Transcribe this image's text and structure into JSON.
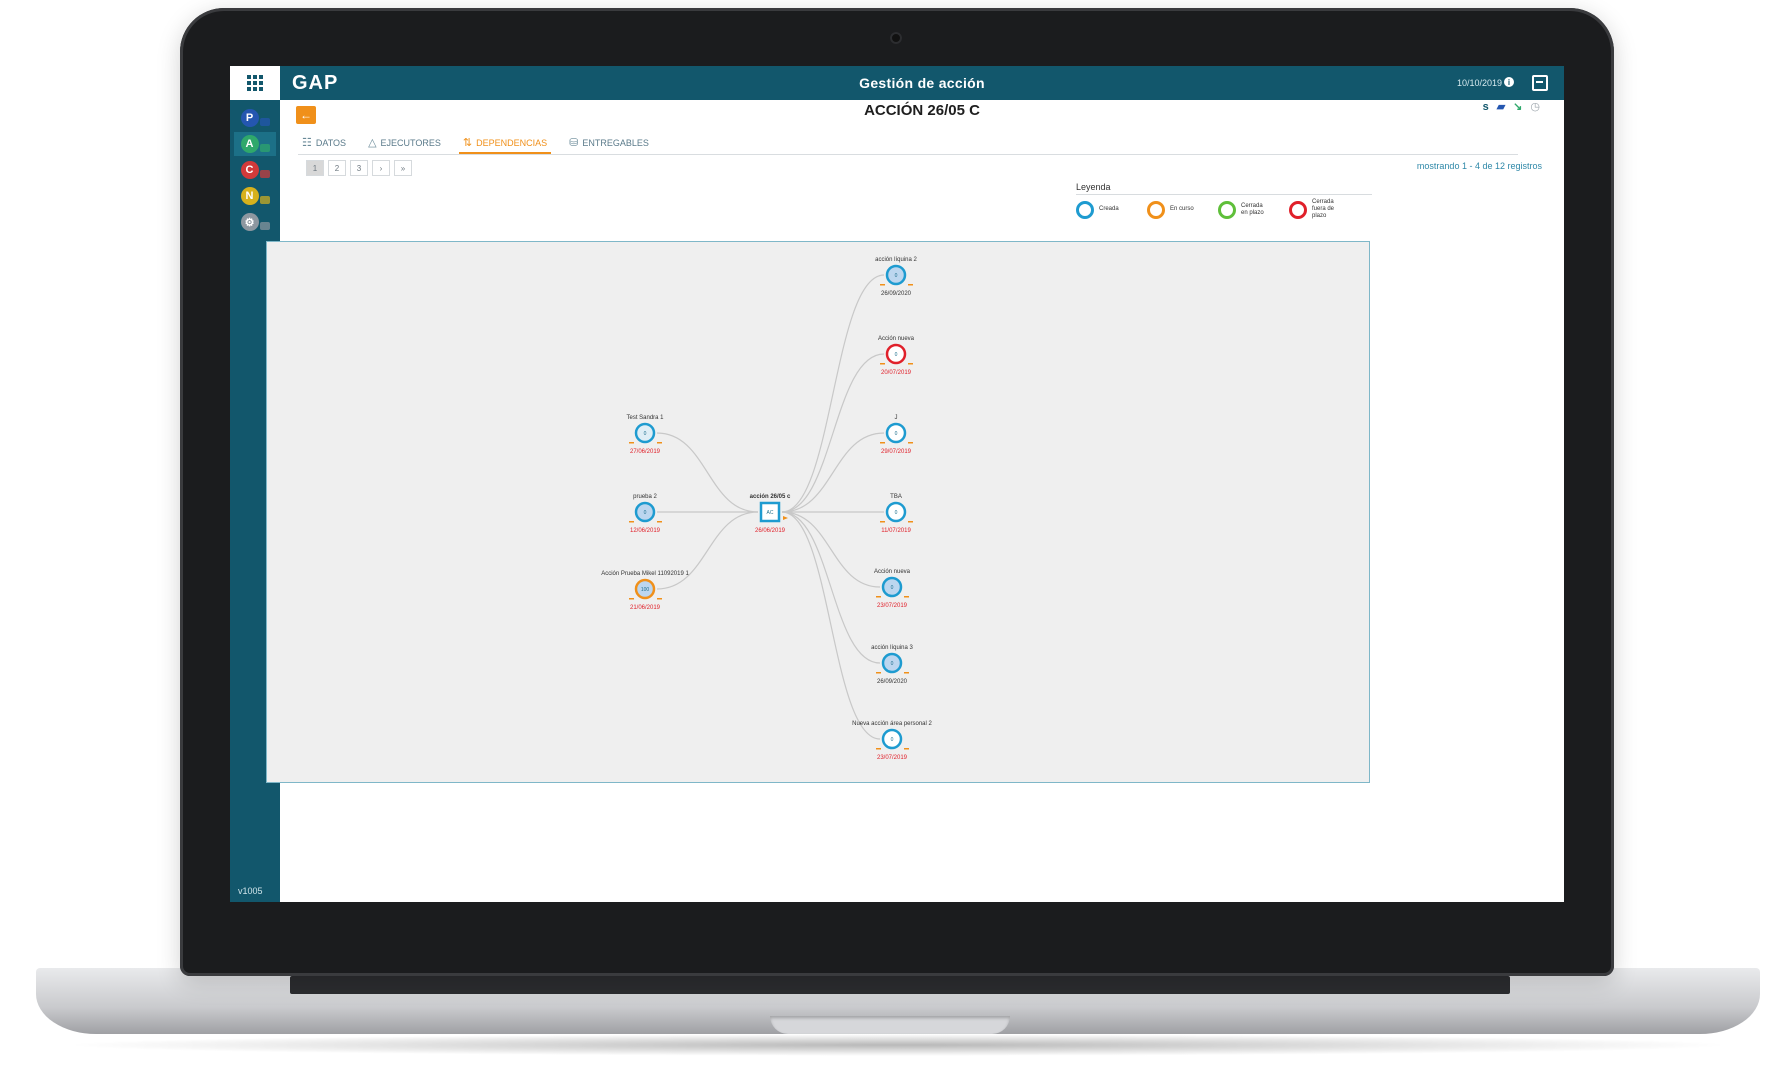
{
  "app": {
    "logo": "GAP",
    "title": "Gestión de acción",
    "date": "10/10/2019",
    "version": "v1005"
  },
  "page": {
    "title": "ACCIÓN 26/05 C",
    "back_icon": "arrow-left-icon",
    "toolbar_icons": [
      "s",
      "folder-icon",
      "tree-icon",
      "clock-icon"
    ]
  },
  "sidebar": {
    "modules": [
      {
        "letter": "P",
        "color": "#2456b0",
        "active": false
      },
      {
        "letter": "A",
        "color": "#2fa86b",
        "active": true
      },
      {
        "letter": "C",
        "color": "#d23a3a",
        "active": false
      },
      {
        "letter": "N",
        "color": "#d6b11c",
        "active": false
      },
      {
        "letter": "⚙",
        "color": "#8d97a0",
        "active": false
      }
    ]
  },
  "tabs": [
    {
      "label": "DATOS",
      "icon": "list-icon",
      "active": false
    },
    {
      "label": "EJECUTORES",
      "icon": "triangle-icon",
      "active": false
    },
    {
      "label": "DEPENDENCIAS",
      "icon": "dependencies-icon",
      "active": true
    },
    {
      "label": "ENTREGABLES",
      "icon": "deliverables-icon",
      "active": false
    }
  ],
  "pagination": {
    "pages": [
      "1",
      "2",
      "3",
      "›",
      "»"
    ],
    "current": "1",
    "records_text": "mostrando 1 - 4 de 12 registros"
  },
  "legend": {
    "title": "Leyenda",
    "items": [
      {
        "label": "Creada",
        "color": "#1e9bd0"
      },
      {
        "label": "En curso",
        "color": "#f0901a"
      },
      {
        "label": "Cerrada en plazo",
        "color": "#5fbf3a"
      },
      {
        "label": "Cerrada fuera de plazo",
        "color": "#e0202a"
      }
    ]
  },
  "graph": {
    "center": {
      "title": "acción 26/05 c",
      "inner": "AC",
      "date": "26/06/2019",
      "date_color": "#e0202a"
    },
    "left_nodes": [
      {
        "title": "Test Sandra 1",
        "inner": "0",
        "date": "27/06/2019",
        "ring": "#1e9bd0",
        "fill": "#dfeef6",
        "date_color": "#e0202a"
      },
      {
        "title": "prueba 2",
        "inner": "0",
        "date": "12/06/2019",
        "ring": "#1e9bd0",
        "fill": "#bcd6ef",
        "date_color": "#e0202a"
      },
      {
        "title": "Acción Prueba Mikel 11092019 1",
        "inner": "100",
        "date": "21/06/2019",
        "ring": "#f0901a",
        "fill": "#bcd6ef",
        "date_color": "#e0202a"
      }
    ],
    "right_nodes": [
      {
        "title": "acción líquina 2",
        "inner": "0",
        "date": "26/09/2020",
        "ring": "#1e9bd0",
        "fill": "#bcd6ef",
        "date_color": "#333333"
      },
      {
        "title": "Acción nueva",
        "inner": "0",
        "date": "20/07/2019",
        "ring": "#e0202a",
        "fill": "#ffffff",
        "date_color": "#e0202a"
      },
      {
        "title": "J",
        "inner": "0",
        "date": "29/07/2019",
        "ring": "#1e9bd0",
        "fill": "#ffffff",
        "date_color": "#e0202a"
      },
      {
        "title": "TBA",
        "inner": "0",
        "date": "11/07/2019",
        "ring": "#1e9bd0",
        "fill": "#ffffff",
        "date_color": "#e0202a"
      },
      {
        "title": "Acción nueva",
        "inner": "0",
        "date": "23/07/2019",
        "ring": "#1e9bd0",
        "fill": "#bcd6ef",
        "date_color": "#e0202a"
      },
      {
        "title": "acción líquina 3",
        "inner": "0",
        "date": "26/09/2020",
        "ring": "#1e9bd0",
        "fill": "#bcd6ef",
        "date_color": "#333333"
      },
      {
        "title": "Nueva acción área personal 2",
        "inner": "0",
        "date": "23/07/2019",
        "ring": "#1e9bd0",
        "fill": "#ffffff",
        "date_color": "#e0202a"
      }
    ]
  }
}
